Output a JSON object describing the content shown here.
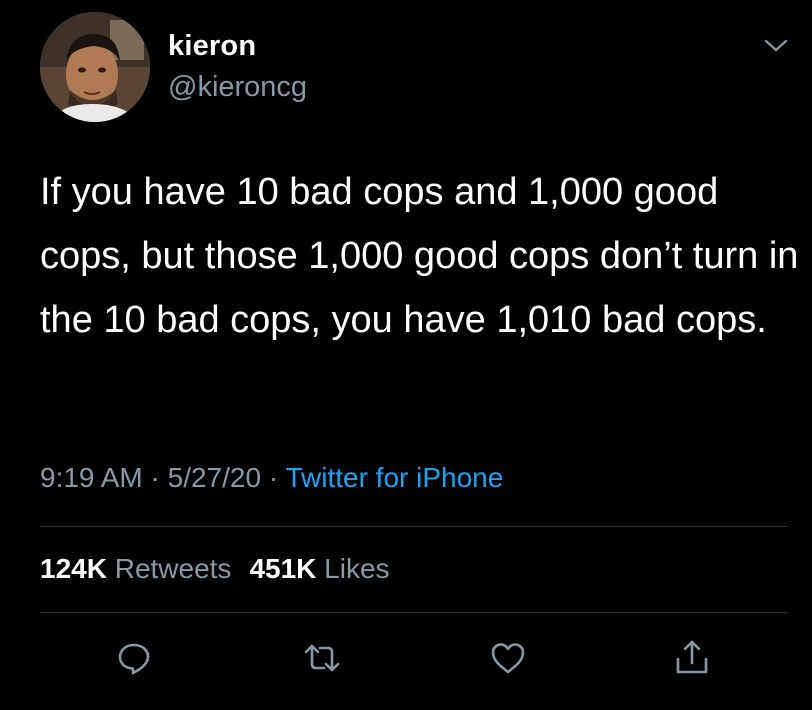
{
  "tweet": {
    "display_name": "kieron",
    "handle": "@kieroncg",
    "text": "If you have 10 bad cops and 1,000 good cops, but those 1,000 good cops don’t turn in the 10 bad cops, you have 1,010 bad cops.",
    "time": "9:19 AM",
    "date": "5/27/20",
    "source": "Twitter for iPhone",
    "separator": "·"
  },
  "stats": {
    "retweets_count": "124K",
    "retweets_label": "Retweets",
    "likes_count": "451K",
    "likes_label": "Likes"
  },
  "icons": {
    "caret": "chevron-down-icon",
    "reply": "reply-icon",
    "retweet": "retweet-icon",
    "like": "heart-icon",
    "share": "share-icon"
  },
  "colors": {
    "background": "#000000",
    "text": "#ffffff",
    "secondary": "#8899a6",
    "link": "#1da1f2",
    "divider": "#2f3336"
  }
}
